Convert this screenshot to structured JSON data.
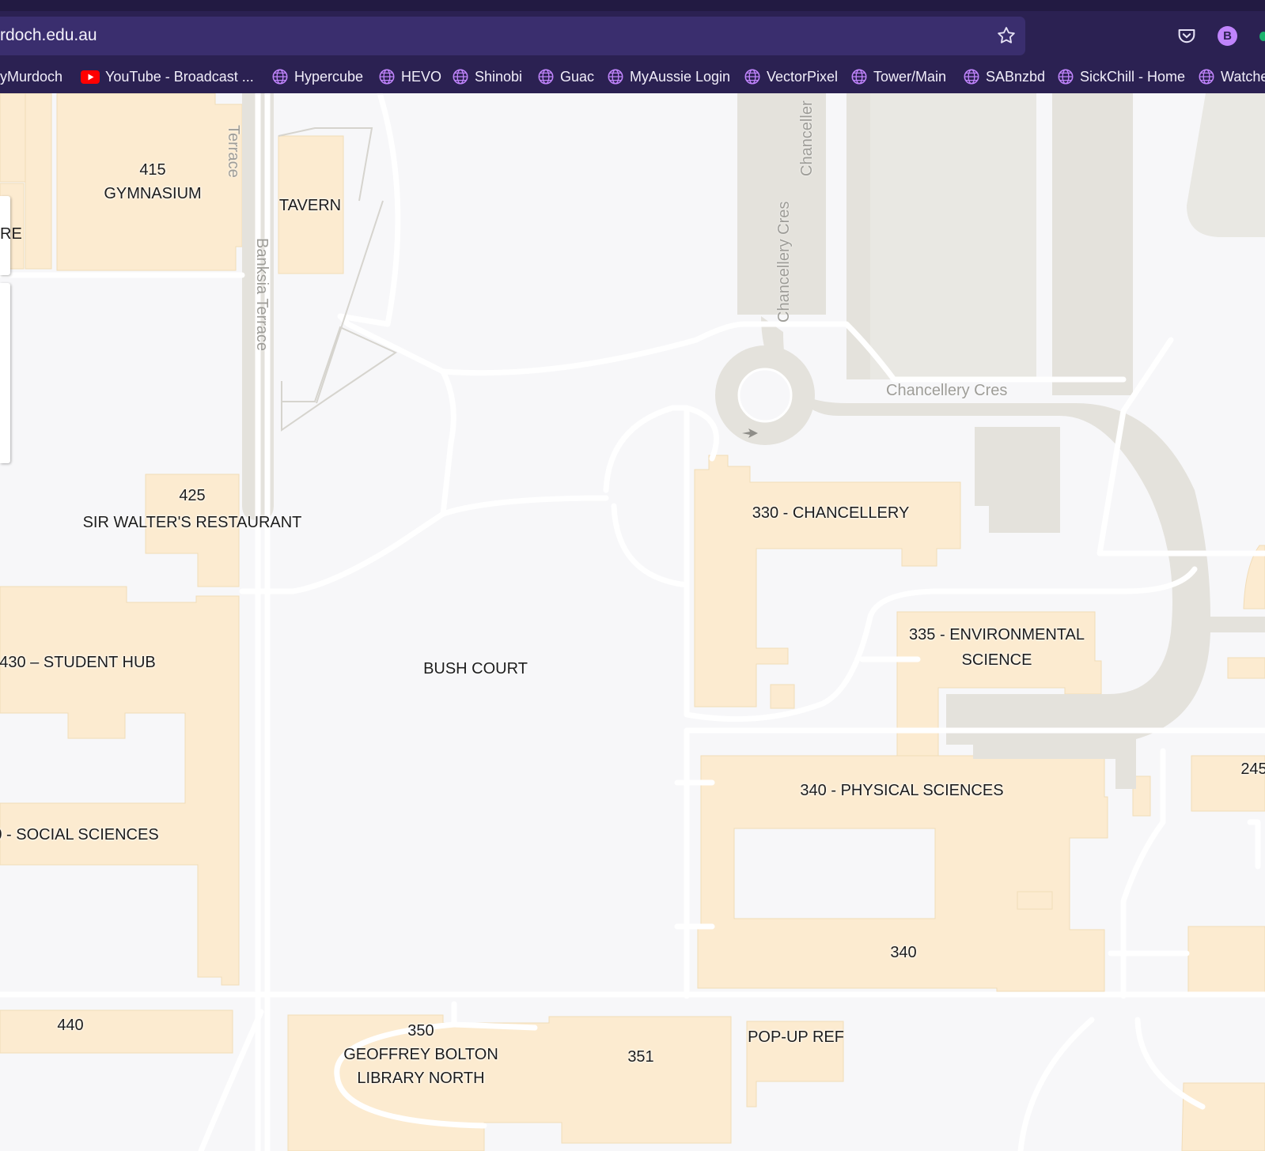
{
  "browser": {
    "url": "rdoch.edu.au",
    "profile_initial": "B",
    "colors": {
      "frame": "#2b2152",
      "urlbar": "#3a2e6e",
      "accent": "#c084fc"
    },
    "bookmarks": [
      {
        "label": "yMurdoch",
        "icon": "none"
      },
      {
        "label": "YouTube - Broadcast ...",
        "icon": "youtube-icon"
      },
      {
        "label": "Hypercube",
        "icon": "globe-icon"
      },
      {
        "label": "HEVO",
        "icon": "globe-icon"
      },
      {
        "label": "Shinobi",
        "icon": "globe-icon"
      },
      {
        "label": "Guac",
        "icon": "globe-icon"
      },
      {
        "label": "MyAussie Login",
        "icon": "globe-icon"
      },
      {
        "label": "VectorPixel",
        "icon": "globe-icon"
      },
      {
        "label": "Tower/Main",
        "icon": "globe-icon"
      },
      {
        "label": "SABnzbd",
        "icon": "globe-icon"
      },
      {
        "label": "SickChill - Home",
        "icon": "globe-icon"
      },
      {
        "label": "Watche",
        "icon": "globe-icon"
      }
    ]
  },
  "map": {
    "colors": {
      "background": "#f7f7f9",
      "building": "#fcebd0",
      "road": "#e4e2dc",
      "path": "#ffffff"
    },
    "panel_fragment": "RE",
    "buildings": [
      {
        "line1": "415",
        "line2": "GYMNASIUM"
      },
      {
        "line1": "TAVERN"
      },
      {
        "line1": "425",
        "line2": "SIR WALTER'S RESTAURANT"
      },
      {
        "line1": "430 – STUDENT HUB"
      },
      {
        "line1": "BUSH COURT"
      },
      {
        "line1": "0 - SOCIAL SCIENCES"
      },
      {
        "line1": "330 - CHANCELLERY"
      },
      {
        "line1": "335 - ENVIRONMENTAL",
        "line2": "SCIENCE"
      },
      {
        "line1": "340 - PHYSICAL SCIENCES"
      },
      {
        "line1": "340"
      },
      {
        "line1": "245"
      },
      {
        "line1": "440"
      },
      {
        "line1": "350",
        "line2": "GEOFFREY BOLTON",
        "line3": "LIBRARY NORTH"
      },
      {
        "line1": "351"
      },
      {
        "line1": "POP-UP REF"
      }
    ],
    "streets": [
      {
        "name": "Terrace"
      },
      {
        "name": "Banksia Terrace"
      },
      {
        "name": "Chancellery Cres"
      },
      {
        "name": "Chanceller"
      },
      {
        "name": "Chancellery Cres"
      },
      {
        "name": "Chancellery Cres"
      }
    ]
  }
}
